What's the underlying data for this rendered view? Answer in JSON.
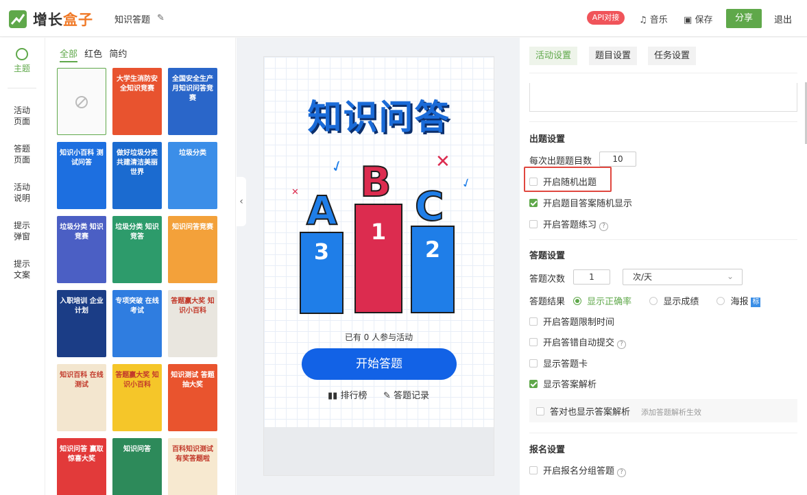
{
  "brand": {
    "name_a": "增长",
    "name_b": "盒子",
    "accent": "#5fa84a"
  },
  "header": {
    "doc_title": "知识答题",
    "api_label": "API对接",
    "music_label": "音乐",
    "save_label": "保存",
    "share_label": "分享",
    "logout_label": "退出"
  },
  "leftnav": {
    "theme": "主题",
    "items": [
      {
        "l1": "活动",
        "l2": "页面"
      },
      {
        "l1": "答题",
        "l2": "页面"
      },
      {
        "l1": "活动",
        "l2": "说明"
      },
      {
        "l1": "提示",
        "l2": "弹窗"
      },
      {
        "l1": "提示",
        "l2": "文案"
      }
    ]
  },
  "templates": {
    "filters": [
      "全部",
      "红色",
      "简约"
    ],
    "cards": [
      {
        "title": "",
        "bg": "#fafafa"
      },
      {
        "title": "大学生消防安全知识竞赛",
        "bg": "#e8532f"
      },
      {
        "title": "全国安全生产月知识问答竞赛",
        "bg": "#2a66c9"
      },
      {
        "title": "知识小百科 测试问答",
        "bg": "#1d6fe0"
      },
      {
        "title": "做好垃圾分类 共建清洁美丽世界",
        "bg": "#1b6bd0"
      },
      {
        "title": "垃圾分类",
        "bg": "#3b8ee8"
      },
      {
        "title": "垃圾分类 知识竞赛",
        "bg": "#4b5fc4"
      },
      {
        "title": "垃圾分类 知识竞答",
        "bg": "#2d9b6b"
      },
      {
        "title": "知识问答竞赛",
        "bg": "#f3a13a"
      },
      {
        "title": "入职培训 企业计划",
        "bg": "#1b3d86"
      },
      {
        "title": "专项突破 在线考试",
        "bg": "#2f7de0"
      },
      {
        "title": "答题赢大奖 知识小百科",
        "bg": "#e9e6df"
      },
      {
        "title": "知识百科 在线测试",
        "bg": "#f3e6cf"
      },
      {
        "title": "答题赢大奖 知识小百科",
        "bg": "#f5c629"
      },
      {
        "title": "知识测试 答题抽大奖",
        "bg": "#e9542e"
      },
      {
        "title": "知识问答 赢取惊喜大奖",
        "bg": "#e23a3a"
      },
      {
        "title": "知识问答",
        "bg": "#2d8a5a"
      },
      {
        "title": "百科知识测试 有奖答题啦",
        "bg": "#f7e9d0"
      }
    ]
  },
  "preview": {
    "title": "知识问答",
    "letters": [
      "A",
      "B",
      "C"
    ],
    "numbers": [
      "3",
      "1",
      "2"
    ],
    "participants": "已有 0 人参与活动",
    "start_button": "开始答题",
    "rank_link": "排行榜",
    "record_link": "答题记录"
  },
  "settings": {
    "tabs": [
      "活动设置",
      "题目设置",
      "任务设置"
    ],
    "question_section": {
      "title": "出题设置",
      "per_count_label": "每次出题题目数",
      "per_count_value": "10",
      "random_order": {
        "label": "开启随机出题",
        "checked": false
      },
      "random_answers": {
        "label": "开启题目答案随机显示",
        "checked": true
      },
      "practice": {
        "label": "开启答题练习",
        "checked": false
      }
    },
    "answer_section": {
      "title": "答题设置",
      "times_label": "答题次数",
      "times_value": "1",
      "period_value": "次/天",
      "result_label": "答题结果",
      "result_options": [
        "显示正确率",
        "显示成绩",
        "海报"
      ],
      "result_selected": "显示正确率",
      "poster_badge": "标",
      "time_limit": {
        "label": "开启答题限制时间",
        "checked": false
      },
      "auto_submit": {
        "label": "开启答错自动提交",
        "checked": false
      },
      "answer_card": {
        "label": "显示答题卡",
        "checked": false
      },
      "show_analysis": {
        "label": "显示答案解析",
        "checked": true
      },
      "correct_analysis": {
        "label": "答对也显示答案解析",
        "checked": false,
        "hint": "添加答题解析生效"
      }
    },
    "signup_section": {
      "title": "报名设置",
      "group_answer": {
        "label": "开启报名分组答题",
        "checked": false
      }
    }
  }
}
